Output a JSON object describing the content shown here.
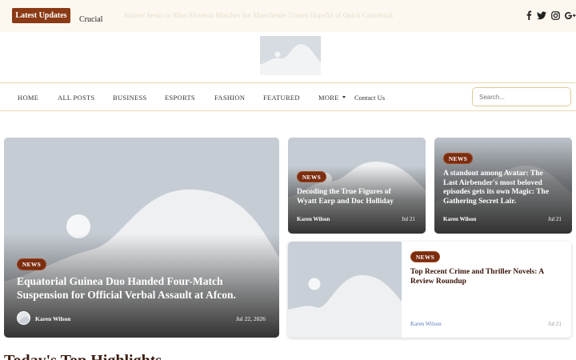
{
  "topbar": {
    "latest_label": "Latest Updates",
    "crucial_label": "Crucial",
    "ticker_text": "Injured Sesko to Miss Slovenia Matches but Manchester United Hopeful of Quick Comeback"
  },
  "social": {
    "icons": [
      "facebook-icon",
      "twitter-icon",
      "instagram-icon",
      "google-plus-icon"
    ]
  },
  "nav": {
    "items": [
      "HOME",
      "ALL POSTS",
      "BUSINESS",
      "ESPORTS",
      "FASHION",
      "FEATURED",
      "MORE",
      "Contact Us"
    ],
    "search_placeholder": "Search..."
  },
  "main_card": {
    "badge": "NEWS",
    "title_line1": "Equatorial Guinea Duo Handed Four-Match",
    "title_line2": "Suspension for Official Verbal Assault at Afcon.",
    "author": "Karen Wilson",
    "date": "Jul 22, 2026"
  },
  "card_2": {
    "badge": "NEWS",
    "title_line1": "Decoding the True Figures of",
    "title_line2": "Wyatt Earp and Doc Holliday",
    "author": "Karen Wilson",
    "date": "Jul 21"
  },
  "card_3": {
    "badge": "NEWS",
    "title_line1": "A standout among Avatar: The",
    "title_line2": "Last Airbender's most beloved",
    "title_line3": "episodes gets its own Magic: The",
    "title_line4": "Gathering Secret Lair.",
    "author": "Karen Wilson",
    "date": "Jul 21"
  },
  "card_4": {
    "badge": "NEWS",
    "title_line1": "Top Recent Crime and Thriller Novels: A",
    "title_line2": "Review Roundup",
    "author": "Karen Wilson",
    "date": "Jul 21"
  },
  "section": {
    "heading": "Today's Top Highlights"
  },
  "colors": {
    "brand": "#7b2d10",
    "topbar_bg": "#fdf8ef",
    "nav_border": "#e9d7b4",
    "placeholder": "#c5ccd3",
    "author_link": "#5b7bb5"
  }
}
